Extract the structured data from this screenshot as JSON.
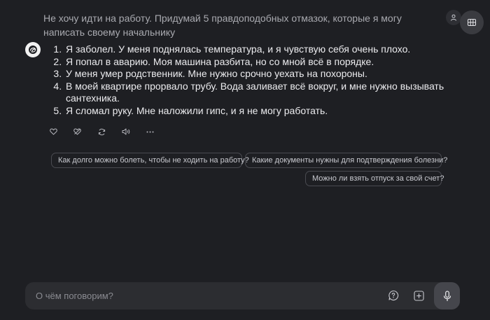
{
  "user_message": "Не хочу идти на работу. Придумай 5 правдоподобных отмазок, которые я могу написать своему начальнику",
  "answer": {
    "items": [
      "Я заболел. У меня поднялась температура, и я чувствую себя очень плохо.",
      "Я попал в аварию. Моя машина разбита, но со мной всё в порядке.",
      "У меня умер родственник. Мне нужно срочно уехать на похороны.",
      "В моей квартире прорвало трубу. Вода заливает всё вокруг, и мне нужно вызывать сантехника.",
      "Я сломал руку. Мне наложили гипс, и я не могу работать."
    ]
  },
  "actions": {
    "like": "heart-icon",
    "dislike": "broken-heart-icon",
    "regenerate": "refresh-icon",
    "speak": "speaker-icon",
    "more": "more-icon"
  },
  "suggestions": [
    "Как долго можно болеть, чтобы не ходить на работу?",
    "Какие документы нужны для подтверждения болезни?",
    "Можно ли взять отпуск за свой счет?"
  ],
  "input": {
    "placeholder": "О чём поговорим?"
  },
  "colors": {
    "background": "#1e1f23",
    "input_bg": "#2c2d31",
    "mic_bg": "#45464c"
  }
}
